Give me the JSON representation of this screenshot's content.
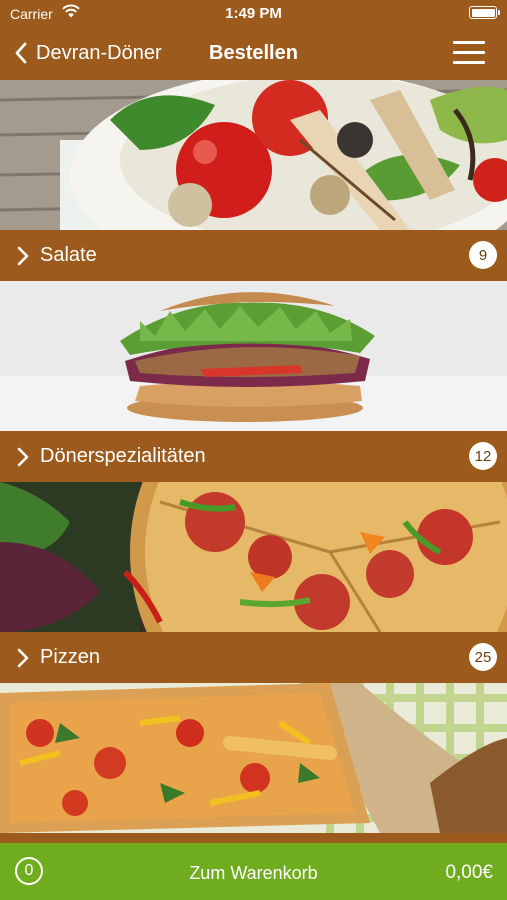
{
  "status_bar": {
    "carrier": "Carrier",
    "time": "1:49 PM"
  },
  "nav": {
    "back_label": "Devran-Döner",
    "title": "Bestellen"
  },
  "categories": [
    {
      "label": "Salate",
      "count": "9"
    },
    {
      "label": "Dönerspezialitäten",
      "count": "12"
    },
    {
      "label": "Pizzen",
      "count": "25"
    },
    {
      "label": "",
      "count": ""
    }
  ],
  "cart": {
    "count": "0",
    "label": "Zum Warenkorb",
    "total": "0,00€"
  },
  "colors": {
    "brand_brown": "#9c5a1c",
    "cart_green": "#6fad1e"
  }
}
